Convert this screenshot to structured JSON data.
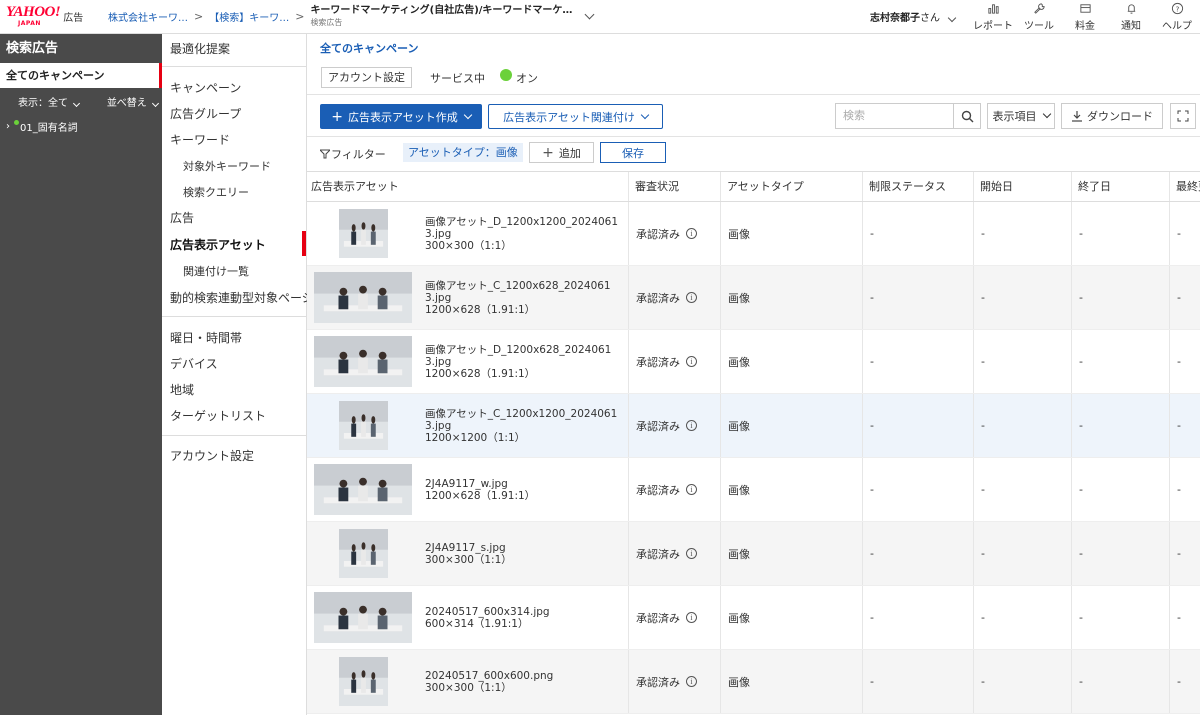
{
  "header": {
    "logo_word": "YAHOO!",
    "logo_sub": "JAPAN",
    "logo_product": "広告",
    "crumb1": "株式会社キーワ…",
    "crumb2": "【検索】キーワ…",
    "crumb3_title": "キーワードマーケティング(自社広告)/キーワードマーケ…",
    "crumb3_sub": "検索広告",
    "user_name": "志村奈都子",
    "user_suffix": "さん",
    "icons": [
      {
        "label": "レポート",
        "icon": "bar-chart-icon"
      },
      {
        "label": "ツール",
        "icon": "wrench-icon"
      },
      {
        "label": "料金",
        "icon": "billing-icon"
      },
      {
        "label": "通知",
        "icon": "bell-icon"
      },
      {
        "label": "ヘルプ",
        "icon": "help-icon"
      }
    ]
  },
  "leftnav": {
    "title": "検索広告",
    "all_campaigns": "全てのキャンペーン",
    "view": "表示：全て",
    "sort": "並べ替え",
    "tree_item": "01_固有名詞"
  },
  "subnav": {
    "items": [
      {
        "label": "最適化提案"
      },
      {
        "label": "キャンペーン"
      },
      {
        "label": "広告グループ"
      },
      {
        "label": "キーワード"
      },
      {
        "label": "対象外キーワード"
      },
      {
        "label": "検索クエリー"
      },
      {
        "label": "広告"
      },
      {
        "label": "広告表示アセット"
      },
      {
        "label": "関連付け一覧"
      },
      {
        "label": "動的検索連動型対象ページ"
      },
      {
        "label": "曜日・時間帯"
      },
      {
        "label": "デバイス"
      },
      {
        "label": "地域"
      },
      {
        "label": "ターゲットリスト"
      },
      {
        "label": "アカウント設定"
      }
    ]
  },
  "main": {
    "heading": "全てのキャンペーン",
    "account_settings_btn": "アカウント設定",
    "service_label": "サービス中",
    "service_value": "オン",
    "create_btn": "広告表示アセット作成",
    "link_btn": "広告表示アセット関連付け",
    "search_placeholder": "検索",
    "display_items_btn": "表示項目",
    "download_btn": "ダウンロード",
    "filter_label": "フィルター",
    "filter_chip": "アセットタイプ：画像",
    "add_btn": "追加",
    "save_btn": "保存"
  },
  "table": {
    "headers": [
      "広告表示アセット",
      "審査状況",
      "アセットタイプ",
      "制限ステータス",
      "開始日",
      "終了日",
      "最終更"
    ],
    "rows": [
      {
        "name": "画像アセット_D_1200x1200_20240613.jpg",
        "size": "300×300（1:1）",
        "status": "承認済み",
        "type": "画像",
        "limit": "-",
        "start": "-",
        "end": "-",
        "last": "-",
        "shape": "sq"
      },
      {
        "name": "画像アセット_C_1200x628_20240613.jpg",
        "size": "1200×628（1.91:1）",
        "status": "承認済み",
        "type": "画像",
        "limit": "-",
        "start": "-",
        "end": "-",
        "last": "-",
        "shape": "wide"
      },
      {
        "name": "画像アセット_D_1200x628_20240613.jpg",
        "size": "1200×628（1.91:1）",
        "status": "承認済み",
        "type": "画像",
        "limit": "-",
        "start": "-",
        "end": "-",
        "last": "-",
        "shape": "wide"
      },
      {
        "name": "画像アセット_C_1200x1200_20240613.jpg",
        "size": "1200×1200（1:1）",
        "status": "承認済み",
        "type": "画像",
        "limit": "-",
        "start": "-",
        "end": "-",
        "last": "-",
        "shape": "sq"
      },
      {
        "name": "2J4A9117_w.jpg",
        "size": "1200×628（1.91:1）",
        "status": "承認済み",
        "type": "画像",
        "limit": "-",
        "start": "-",
        "end": "-",
        "last": "-",
        "shape": "wide"
      },
      {
        "name": "2J4A9117_s.jpg",
        "size": "300×300（1:1）",
        "status": "承認済み",
        "type": "画像",
        "limit": "-",
        "start": "-",
        "end": "-",
        "last": "-",
        "shape": "sq"
      },
      {
        "name": "20240517_600x314.jpg",
        "size": "600×314（1.91:1）",
        "status": "承認済み",
        "type": "画像",
        "limit": "-",
        "start": "-",
        "end": "-",
        "last": "-",
        "shape": "wide"
      },
      {
        "name": "20240517_600x600.png",
        "size": "300×300（1:1）",
        "status": "承認済み",
        "type": "画像",
        "limit": "-",
        "start": "-",
        "end": "-",
        "last": "-",
        "shape": "sq"
      }
    ]
  },
  "colors": {
    "brand_red": "#ff0033",
    "primary_blue": "#1a5eb5",
    "status_green": "#6bd13a",
    "nav_dark": "#4a4a4a"
  }
}
